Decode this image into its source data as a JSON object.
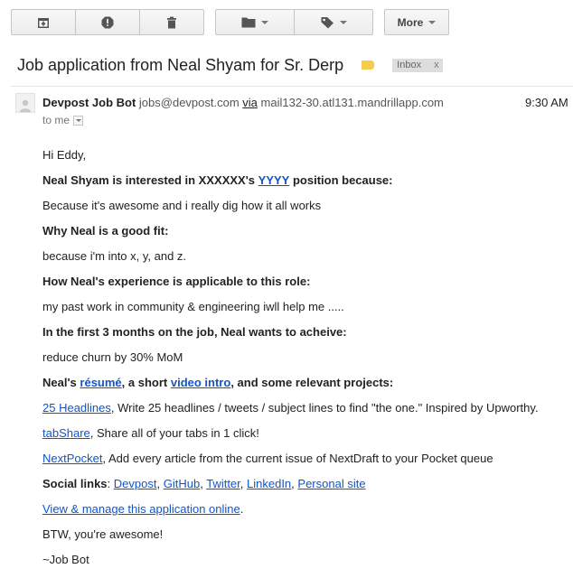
{
  "toolbar": {
    "archive_icon": "archive-icon",
    "spam_icon": "report-spam-icon",
    "delete_icon": "trash-icon",
    "move_icon": "folder-icon",
    "labels_icon": "label-tag-icon",
    "more_label": "More"
  },
  "message": {
    "subject": "Job application from Neal Shyam for Sr. Derp",
    "label_color": "#f7cb4d",
    "inbox_chip": "Inbox",
    "inbox_chip_remove": "x",
    "sender_name": "Devpost Job Bot",
    "sender_email": "jobs@devpost.com",
    "via_label": "via",
    "via_host": "mail132-30.atl131.mandrillapp.com",
    "time": "9:30 AM",
    "to": "to me"
  },
  "body": {
    "greeting": "Hi Eddy,",
    "interest_prefix": "Neal Shyam is interested in XXXXXX's",
    "interest_link": "YYYY",
    "interest_suffix": "position because:",
    "because": "Because it's awesome and i really dig how it all works",
    "fit_heading": "Why Neal is a good fit:",
    "fit": "because i'm into x, y, and z.",
    "exp_heading": "How Neal's experience is applicable to this role:",
    "exp": "my past work in community & engineering iwll help me .....",
    "goal_heading": "In the first 3 months on the job, Neal wants to acheive:",
    "goal": "reduce churn by 30% MoM",
    "projects_prefix": "Neal's",
    "resume_link": "résumé",
    "projects_mid": ", a short",
    "video_link": "video intro",
    "projects_suffix": ", and some relevant projects:",
    "projects": [
      {
        "link": "25 Headlines",
        "text": ", Write 25 headlines / tweets / subject lines to find \"the one.\" Inspired by Upworthy."
      },
      {
        "link": "tabShare",
        "text": ", Share all of your tabs in 1 click!"
      },
      {
        "link": "NextPocket",
        "text": ", Add every article from the current issue of NextDraft to your Pocket queue"
      }
    ],
    "social_label": "Social links",
    "social_colon": ":",
    "social_links": [
      "Devpost",
      "GitHub",
      "Twitter",
      "LinkedIn",
      "Personal site"
    ],
    "manage_link": "View & manage this application online",
    "manage_period": ".",
    "btw": "BTW, you're awesome!",
    "signoff": "~Job Bot"
  },
  "colors": {
    "link": "#1155cc",
    "label_yellow": "#f7cb4d",
    "chip_bg": "#dddddd"
  }
}
